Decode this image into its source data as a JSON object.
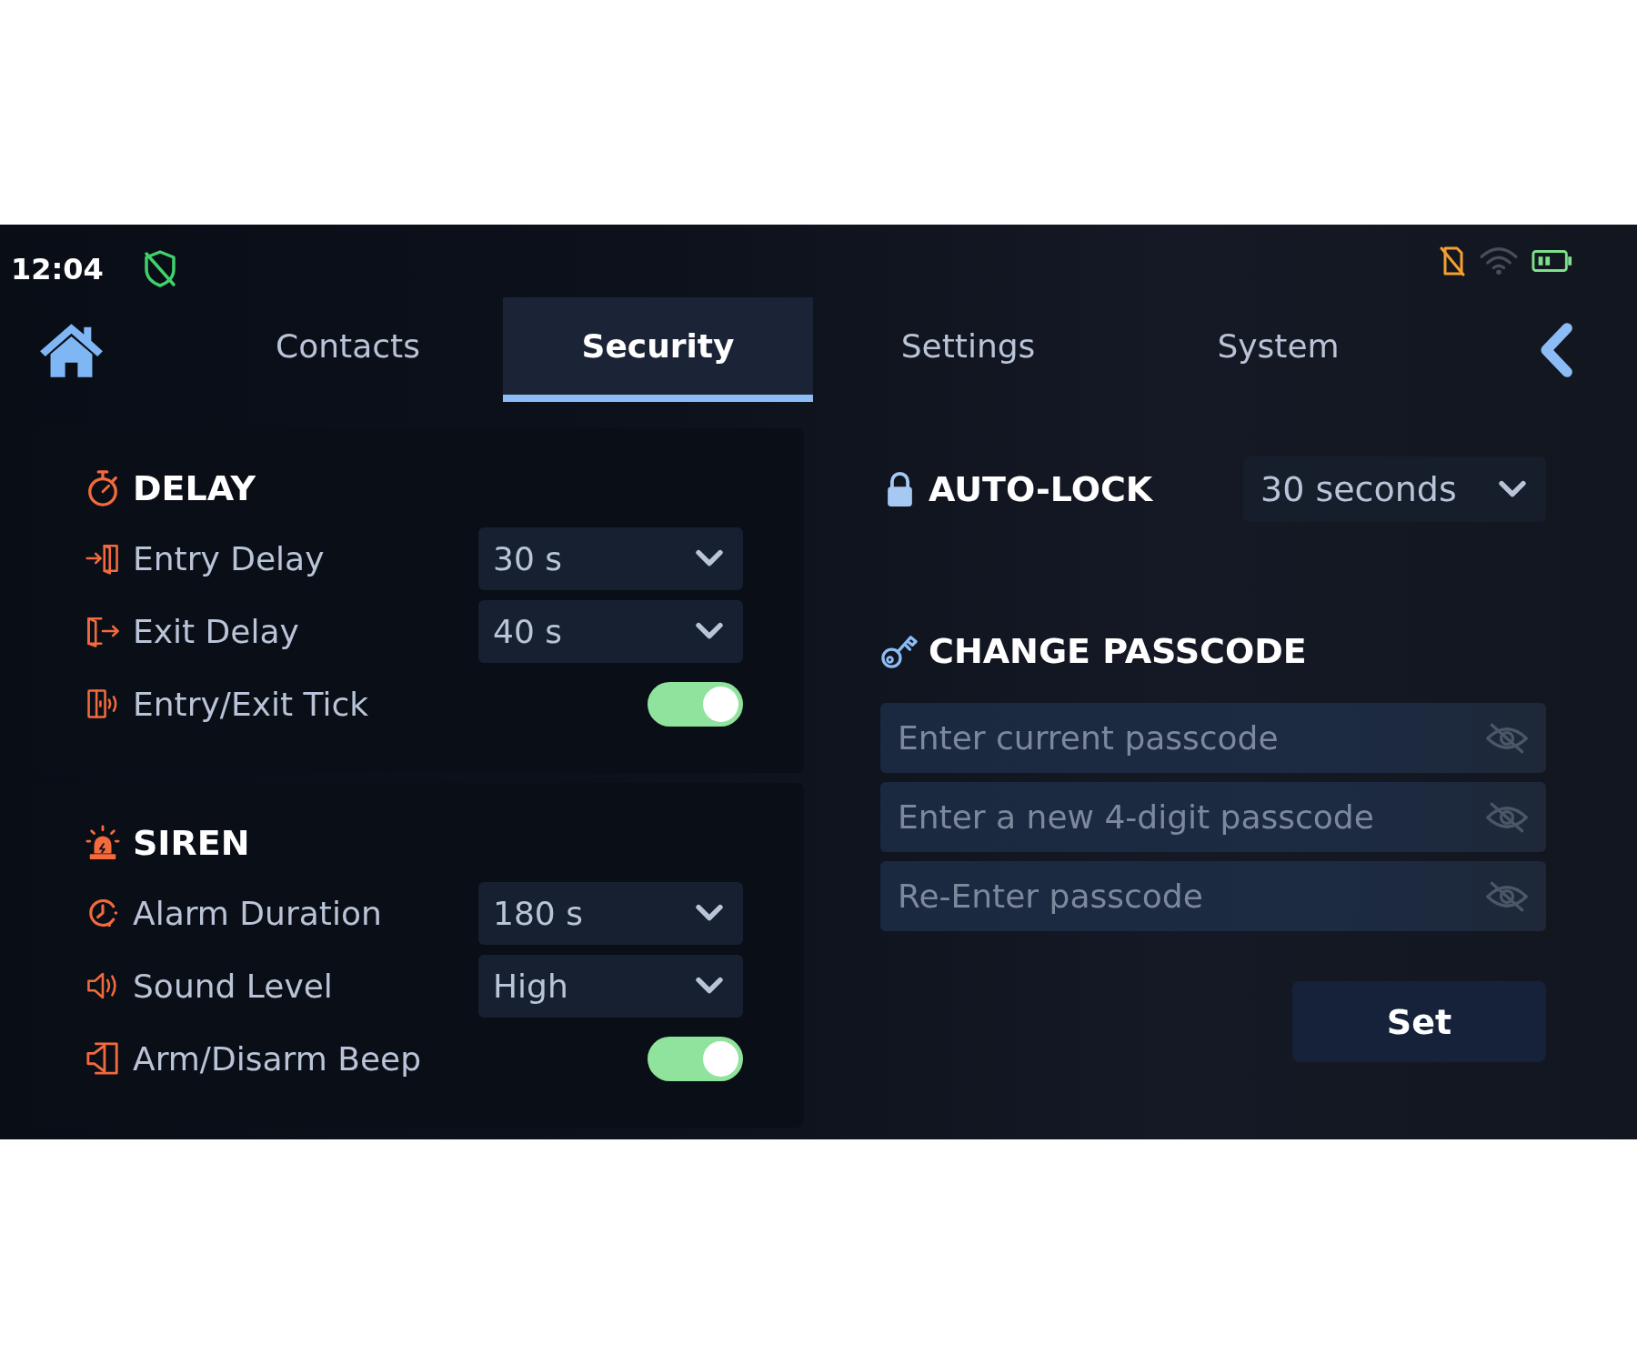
{
  "status_bar": {
    "time": "12:04"
  },
  "tabs": [
    {
      "label": "Contacts",
      "selected": false
    },
    {
      "label": "Security",
      "selected": true
    },
    {
      "label": "Settings",
      "selected": false
    },
    {
      "label": "System",
      "selected": false
    }
  ],
  "sections": [
    {
      "title": "DELAY",
      "rows": [
        {
          "kind": "dropdown",
          "label": "Entry Delay",
          "value": "30 s"
        },
        {
          "kind": "dropdown",
          "label": "Exit Delay",
          "value": "40 s"
        },
        {
          "kind": "toggle",
          "label": "Entry/Exit Tick",
          "on": true
        }
      ]
    },
    {
      "title": "SIREN",
      "rows": [
        {
          "kind": "dropdown",
          "label": "Alarm Duration",
          "value": "180 s"
        },
        {
          "kind": "dropdown",
          "label": "Sound Level",
          "value": "High"
        },
        {
          "kind": "toggle",
          "label": "Arm/Disarm Beep",
          "on": true
        }
      ]
    }
  ],
  "auto_lock": {
    "title": "AUTO-LOCK",
    "value": "30 seconds"
  },
  "change_passcode": {
    "title": "CHANGE PASSCODE",
    "fields": [
      {
        "placeholder": "Enter current passcode"
      },
      {
        "placeholder": "Enter a new 4-digit passcode"
      },
      {
        "placeholder": "Re-Enter passcode"
      }
    ],
    "button": "Set"
  }
}
